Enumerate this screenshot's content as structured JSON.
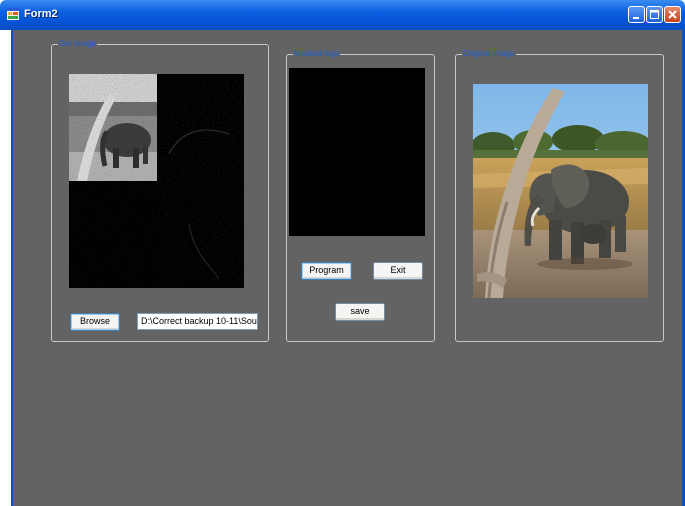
{
  "window": {
    "title": "Form2"
  },
  "groups": {
    "get_image": {
      "label": "Get image"
    },
    "masked": {
      "label": "Masked logo"
    },
    "original": {
      "label": "Original image"
    }
  },
  "buttons": {
    "browse": "Browse",
    "program": "Program",
    "exit": "Exit",
    "save": "save"
  },
  "path_field": {
    "value": "D:\\Correct backup 10-11\\Sour"
  },
  "colors": {
    "client_bg": "#636363",
    "legend_text": "#1e5fd6",
    "titlebar": "#0b5fe0"
  },
  "icons": [
    "app-icon",
    "minimize-icon",
    "maximize-icon",
    "close-icon"
  ],
  "images": {
    "wavelet_preview": "wavelet decomposition of elephant image (4 subbands)",
    "masked_logo": "black picture box",
    "original_image": "elephant next to tree trunk"
  }
}
